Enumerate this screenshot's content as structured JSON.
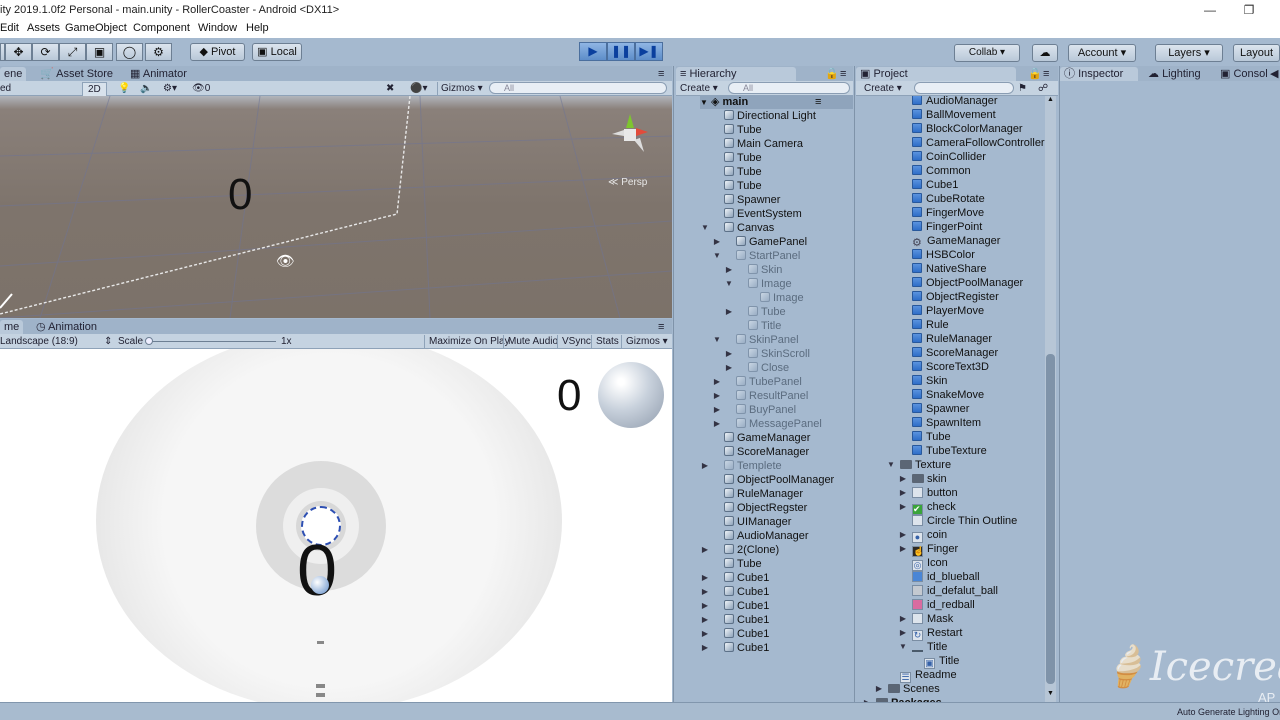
{
  "window": {
    "title": "ity 2019.1.0f2 Personal - main.unity - RollerCoaster - Android <DX11>"
  },
  "menu": [
    "Edit",
    "Assets",
    "GameObject",
    "Component",
    "Window",
    "Help"
  ],
  "toolbar": {
    "pivot": "Pivot",
    "local": "Local",
    "collab": "Collab",
    "account": "Account",
    "layers": "Layers",
    "layout": "Layout"
  },
  "scene_tabs": [
    "ene",
    "Asset Store",
    "Animator"
  ],
  "scene_bar": {
    "mode": "ed",
    "twod": "2D",
    "gizmos": "Gizmos",
    "search": "All",
    "persp": "Persp",
    "fx_count": "0"
  },
  "scene_view": {
    "score": "0"
  },
  "game_tabs": [
    "me",
    "Animation"
  ],
  "game_bar": {
    "aspect": "Landscape (18:9)",
    "scale_label": "Scale",
    "scale_value": "1x",
    "maximize": "Maximize On Play",
    "mute": "Mute Audio",
    "vsync": "VSync",
    "stats": "Stats",
    "gizmos": "Gizmos"
  },
  "game_view": {
    "score_top": "0",
    "score_center": "0"
  },
  "hierarchy": {
    "title": "Hierarchy",
    "create": "Create",
    "search": "All",
    "scene": "main",
    "items": [
      {
        "label": "Directional Light",
        "indent": 1,
        "arrow": "",
        "dim": false
      },
      {
        "label": "Tube",
        "indent": 1,
        "arrow": "",
        "dim": false
      },
      {
        "label": "Main Camera",
        "indent": 1,
        "arrow": "",
        "dim": false
      },
      {
        "label": "Tube",
        "indent": 1,
        "arrow": "",
        "dim": false
      },
      {
        "label": "Tube",
        "indent": 1,
        "arrow": "",
        "dim": false
      },
      {
        "label": "Tube",
        "indent": 1,
        "arrow": "",
        "dim": false
      },
      {
        "label": "Spawner",
        "indent": 1,
        "arrow": "",
        "dim": false
      },
      {
        "label": "EventSystem",
        "indent": 1,
        "arrow": "",
        "dim": false
      },
      {
        "label": "Canvas",
        "indent": 1,
        "arrow": "down",
        "dim": false
      },
      {
        "label": "GamePanel",
        "indent": 2,
        "arrow": "right",
        "dim": false
      },
      {
        "label": "StartPanel",
        "indent": 2,
        "arrow": "down",
        "dim": true
      },
      {
        "label": "Skin",
        "indent": 3,
        "arrow": "right",
        "dim": true
      },
      {
        "label": "Image",
        "indent": 3,
        "arrow": "down",
        "dim": true
      },
      {
        "label": "Image",
        "indent": 4,
        "arrow": "",
        "dim": true
      },
      {
        "label": "Tube",
        "indent": 3,
        "arrow": "right",
        "dim": true
      },
      {
        "label": "Title",
        "indent": 3,
        "arrow": "",
        "dim": true
      },
      {
        "label": "SkinPanel",
        "indent": 2,
        "arrow": "down",
        "dim": true
      },
      {
        "label": "SkinScroll",
        "indent": 3,
        "arrow": "right",
        "dim": true
      },
      {
        "label": "Close",
        "indent": 3,
        "arrow": "right",
        "dim": true
      },
      {
        "label": "TubePanel",
        "indent": 2,
        "arrow": "right",
        "dim": true
      },
      {
        "label": "ResultPanel",
        "indent": 2,
        "arrow": "right",
        "dim": true
      },
      {
        "label": "BuyPanel",
        "indent": 2,
        "arrow": "right",
        "dim": true
      },
      {
        "label": "MessagePanel",
        "indent": 2,
        "arrow": "right",
        "dim": true
      },
      {
        "label": "GameManager",
        "indent": 1,
        "arrow": "",
        "dim": false
      },
      {
        "label": "ScoreManager",
        "indent": 1,
        "arrow": "",
        "dim": false
      },
      {
        "label": "Templete",
        "indent": 1,
        "arrow": "right",
        "dim": true
      },
      {
        "label": "ObjectPoolManager",
        "indent": 1,
        "arrow": "",
        "dim": false
      },
      {
        "label": "RuleManager",
        "indent": 1,
        "arrow": "",
        "dim": false
      },
      {
        "label": "ObjectRegster",
        "indent": 1,
        "arrow": "",
        "dim": false
      },
      {
        "label": "UIManager",
        "indent": 1,
        "arrow": "",
        "dim": false
      },
      {
        "label": "AudioManager",
        "indent": 1,
        "arrow": "",
        "dim": false
      },
      {
        "label": "2(Clone)",
        "indent": 1,
        "arrow": "right",
        "dim": false
      },
      {
        "label": "Tube",
        "indent": 1,
        "arrow": "",
        "dim": false
      },
      {
        "label": "Cube1",
        "indent": 1,
        "arrow": "right",
        "dim": false
      },
      {
        "label": "Cube1",
        "indent": 1,
        "arrow": "right",
        "dim": false
      },
      {
        "label": "Cube1",
        "indent": 1,
        "arrow": "right",
        "dim": false
      },
      {
        "label": "Cube1",
        "indent": 1,
        "arrow": "right",
        "dim": false
      },
      {
        "label": "Cube1",
        "indent": 1,
        "arrow": "right",
        "dim": false
      },
      {
        "label": "Cube1",
        "indent": 1,
        "arrow": "right",
        "dim": false
      }
    ]
  },
  "project": {
    "title": "Project",
    "create": "Create",
    "items": [
      {
        "label": "AudioManager",
        "type": "script",
        "indent": 3,
        "arrow": ""
      },
      {
        "label": "BallMovement",
        "type": "script",
        "indent": 3,
        "arrow": ""
      },
      {
        "label": "BlockColorManager",
        "type": "script",
        "indent": 3,
        "arrow": ""
      },
      {
        "label": "CameraFollowController",
        "type": "script",
        "indent": 3,
        "arrow": ""
      },
      {
        "label": "CoinCollider",
        "type": "script",
        "indent": 3,
        "arrow": ""
      },
      {
        "label": "Common",
        "type": "script",
        "indent": 3,
        "arrow": ""
      },
      {
        "label": "Cube1",
        "type": "script",
        "indent": 3,
        "arrow": ""
      },
      {
        "label": "CubeRotate",
        "type": "script",
        "indent": 3,
        "arrow": ""
      },
      {
        "label": "FingerMove",
        "type": "script",
        "indent": 3,
        "arrow": ""
      },
      {
        "label": "FingerPoint",
        "type": "script",
        "indent": 3,
        "arrow": ""
      },
      {
        "label": "GameManager",
        "type": "gear",
        "indent": 3,
        "arrow": ""
      },
      {
        "label": "HSBColor",
        "type": "script",
        "indent": 3,
        "arrow": ""
      },
      {
        "label": "NativeShare",
        "type": "script",
        "indent": 3,
        "arrow": ""
      },
      {
        "label": "ObjectPoolManager",
        "type": "script",
        "indent": 3,
        "arrow": ""
      },
      {
        "label": "ObjectRegister",
        "type": "script",
        "indent": 3,
        "arrow": ""
      },
      {
        "label": "PlayerMove",
        "type": "script",
        "indent": 3,
        "arrow": ""
      },
      {
        "label": "Rule",
        "type": "script",
        "indent": 3,
        "arrow": ""
      },
      {
        "label": "RuleManager",
        "type": "script",
        "indent": 3,
        "arrow": ""
      },
      {
        "label": "ScoreManager",
        "type": "script",
        "indent": 3,
        "arrow": ""
      },
      {
        "label": "ScoreText3D",
        "type": "script",
        "indent": 3,
        "arrow": ""
      },
      {
        "label": "Skin",
        "type": "script",
        "indent": 3,
        "arrow": ""
      },
      {
        "label": "SnakeMove",
        "type": "script",
        "indent": 3,
        "arrow": ""
      },
      {
        "label": "Spawner",
        "type": "script",
        "indent": 3,
        "arrow": ""
      },
      {
        "label": "SpawnItem",
        "type": "script",
        "indent": 3,
        "arrow": ""
      },
      {
        "label": "Tube",
        "type": "script",
        "indent": 3,
        "arrow": ""
      },
      {
        "label": "TubeTexture",
        "type": "script",
        "indent": 3,
        "arrow": ""
      },
      {
        "label": "Texture",
        "type": "folder",
        "indent": 2,
        "arrow": "down"
      },
      {
        "label": "skin",
        "type": "folder",
        "indent": 3,
        "arrow": "right"
      },
      {
        "label": "button",
        "type": "img",
        "indent": 3,
        "arrow": "right"
      },
      {
        "label": "check",
        "type": "check",
        "indent": 3,
        "arrow": "right"
      },
      {
        "label": "Circle Thin Outline",
        "type": "img",
        "indent": 3,
        "arrow": ""
      },
      {
        "label": "coin",
        "type": "coin",
        "indent": 3,
        "arrow": "right"
      },
      {
        "label": "Finger",
        "type": "finger",
        "indent": 3,
        "arrow": "right"
      },
      {
        "label": "Icon",
        "type": "icon",
        "indent": 3,
        "arrow": ""
      },
      {
        "label": "id_blueball",
        "type": "blue",
        "indent": 3,
        "arrow": ""
      },
      {
        "label": "id_defalut_ball",
        "type": "grey",
        "indent": 3,
        "arrow": ""
      },
      {
        "label": "id_redball",
        "type": "red",
        "indent": 3,
        "arrow": ""
      },
      {
        "label": "Mask",
        "type": "img",
        "indent": 3,
        "arrow": "right"
      },
      {
        "label": "Restart",
        "type": "restart",
        "indent": 3,
        "arrow": "right"
      },
      {
        "label": "Title",
        "type": "dash",
        "indent": 3,
        "arrow": "down"
      },
      {
        "label": "Title",
        "type": "sprite",
        "indent": 4,
        "arrow": ""
      },
      {
        "label": "Readme",
        "type": "doc",
        "indent": 2,
        "arrow": ""
      },
      {
        "label": "Scenes",
        "type": "folder",
        "indent": 1,
        "arrow": "right"
      },
      {
        "label": "Packages",
        "type": "folder-bold",
        "indent": 0,
        "arrow": "right"
      }
    ]
  },
  "inspector_tabs": [
    "Inspector",
    "Lighting",
    "Consol"
  ],
  "watermark": {
    "brand": "Icecream",
    "sub": "AP"
  },
  "status": {
    "right": "Auto Generate Lighting On"
  }
}
